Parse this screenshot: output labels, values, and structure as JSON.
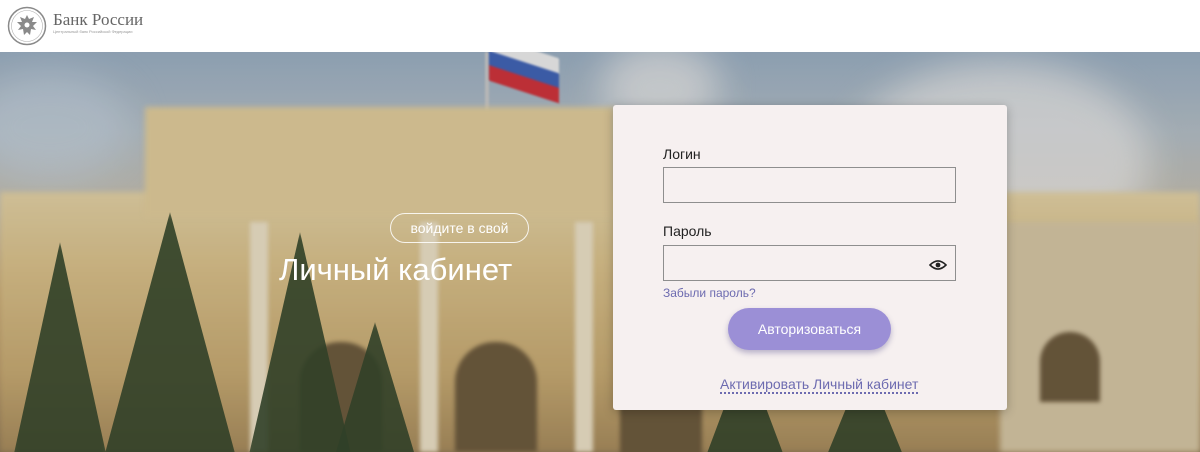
{
  "header": {
    "title": "Банк России",
    "subtitle": "Центральный банк Российской Федерации",
    "emblem_icon": "double-headed-eagle-emblem-icon"
  },
  "hero": {
    "pill_text": "войдите в свой",
    "title": "Личный кабинет"
  },
  "login_form": {
    "login_label": "Логин",
    "login_value": "",
    "password_label": "Пароль",
    "password_value": "",
    "show_password_icon": "eye-icon",
    "forgot_link": "Забыли пароль?",
    "submit_label": "Авторизоваться",
    "activate_link": "Активировать Личный кабинет"
  },
  "colors": {
    "accent": "#9b8fd6",
    "link": "#6d6bb0",
    "card_background": "#f6f0f0"
  }
}
